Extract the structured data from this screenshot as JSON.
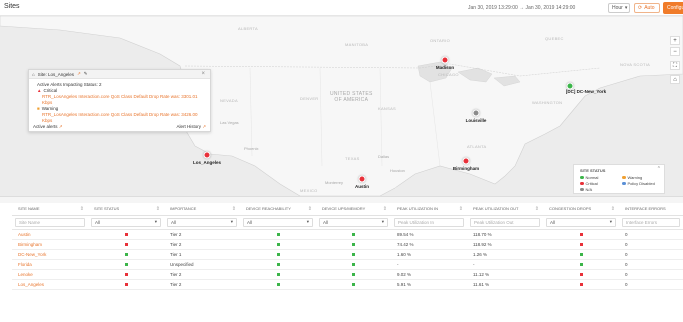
{
  "header": {
    "title": "Sites",
    "date_range": "Jan 30, 2019 13:29:00 → Jan 30, 2019 14:29:00",
    "period": "Hour",
    "refresh": "Auto",
    "configure": "Configure Sit"
  },
  "map": {
    "regions": [
      {
        "label": "ALBERTA"
      },
      {
        "label": "MANITOBA"
      },
      {
        "label": "ONTARIO"
      },
      {
        "label": "QUEBEC"
      },
      {
        "label": "NOVA SCOTIA"
      },
      {
        "label": "NEVADA"
      },
      {
        "label": "DENVER"
      },
      {
        "label": "KANSAS"
      },
      {
        "label": "UNITED STATES\nOF AMERICA"
      },
      {
        "label": "CHICAGO"
      },
      {
        "label": "TEXAS"
      },
      {
        "label": "ATLANTA"
      },
      {
        "label": "MEXICO"
      },
      {
        "label": "WASHINGTON"
      }
    ],
    "cities": [
      {
        "name": "Phoenix"
      },
      {
        "name": "Dallas"
      },
      {
        "name": "Houston"
      },
      {
        "name": "Monterrey"
      },
      {
        "name": "Las Vegas"
      }
    ],
    "sites": [
      {
        "name": "Madison",
        "status": "red"
      },
      {
        "name": "[DC] DC-New_York",
        "status": "green"
      },
      {
        "name": "Louisville",
        "status": "gray"
      },
      {
        "name": "Los_Angeles",
        "status": "red"
      },
      {
        "name": "Birmingham",
        "status": "red"
      },
      {
        "name": "Austin",
        "status": "red"
      }
    ],
    "controls": [
      "+",
      "−",
      "⛶",
      "⌂"
    ]
  },
  "popup": {
    "title": "Site: Los_Angeles",
    "active_alerts_label": "Active Alerts Impacting Status: 2",
    "critical_label": "Critical",
    "critical_text": "RTR_LosAngeles Interaction.core QoS Class Default Drop Rate was: 3301.01 Kbps",
    "warning_label": "Warning",
    "warning_text": "RTR_LosAngeles Interaction.core QoS Class Default Drop Rate was: 3426.00 Kbps",
    "active_link": "Active alerts",
    "history_link": "Alert History"
  },
  "legend": {
    "title": "SITE STATUS",
    "items": [
      {
        "label": "Normal",
        "color": "#3cb54a"
      },
      {
        "label": "Warning",
        "color": "#f0a032"
      },
      {
        "label": "Critical",
        "color": "#e8313a"
      },
      {
        "label": "Policy Disabled",
        "color": "#5a8fd6"
      },
      {
        "label": "N/A",
        "color": "#8b8b8b"
      }
    ]
  },
  "table": {
    "columns": [
      "SITE NAME",
      "SITE STATUS",
      "IMPORTANCE",
      "DEVICE REACHABILITY",
      "DEVICE UPS/MEMORY",
      "PEAK UTILIZATION IN",
      "PEAK UTILIZATION OUT",
      "CONGESTION DROPS",
      "INTERFACE ERRORS"
    ],
    "filters": {
      "site_name": "Site Name",
      "site_status": "All",
      "importance": "All",
      "device_reach": "All",
      "device_ups": "All",
      "peak_in": "Peak Utilization In",
      "peak_out": "Peak Utilization Out",
      "congestion": "All",
      "iface": "Interface Errors"
    },
    "rows": [
      {
        "site": "Austin",
        "status": "red",
        "importance": "Tier 2",
        "reach": "green",
        "ups": "green",
        "peak_in": "89.54 %",
        "peak_out": "118.70 %",
        "congestion": "red",
        "errors": "0"
      },
      {
        "site": "Birmingham",
        "status": "red",
        "importance": "Tier 2",
        "reach": "green",
        "ups": "green",
        "peak_in": "74.42 %",
        "peak_out": "118.92 %",
        "congestion": "red",
        "errors": "0"
      },
      {
        "site": "DC-New_York",
        "status": "green",
        "importance": "Tier 1",
        "reach": "green",
        "ups": "green",
        "peak_in": "1.60 %",
        "peak_out": "1.26 %",
        "congestion": "green",
        "errors": "0"
      },
      {
        "site": "Florida",
        "status": "green",
        "importance": "Unspecified",
        "reach": "green",
        "ups": "green",
        "peak_in": "-",
        "peak_out": "-",
        "congestion": "green",
        "errors": "0"
      },
      {
        "site": "Lenoke",
        "status": "red",
        "importance": "Tier 2",
        "reach": "green",
        "ups": "green",
        "peak_in": "9.02 %",
        "peak_out": "11.12 %",
        "congestion": "red",
        "errors": "0"
      },
      {
        "site": "Los_Angeles",
        "status": "red",
        "importance": "Tier 2",
        "reach": "green",
        "ups": "green",
        "peak_in": "5.91 %",
        "peak_out": "11.61 %",
        "congestion": "red",
        "errors": "0"
      }
    ]
  }
}
